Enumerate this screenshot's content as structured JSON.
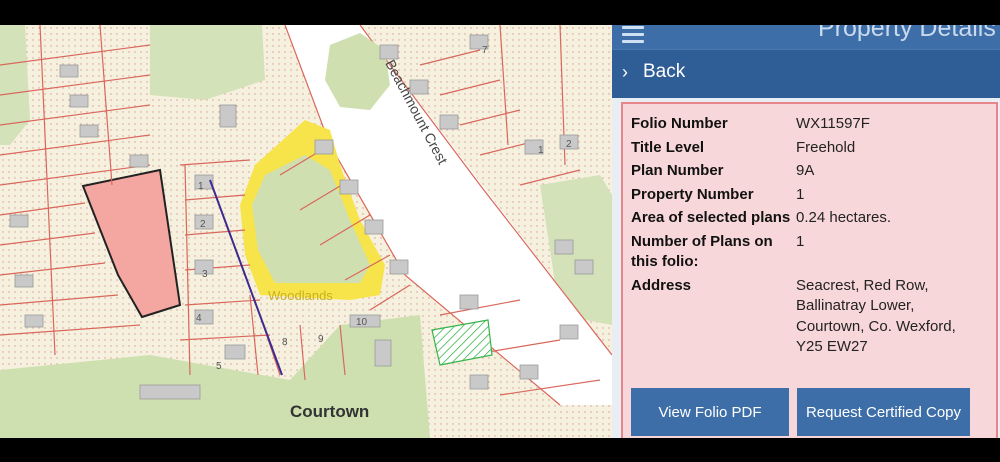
{
  "header": {
    "title": "Property Details",
    "menu_icon": "hamburger-icon"
  },
  "back": {
    "label": "Back",
    "icon": "chevron-right-icon"
  },
  "details": {
    "rows": [
      {
        "label": "Folio Number",
        "value": "WX11597F"
      },
      {
        "label": "Title Level",
        "value": "Freehold"
      },
      {
        "label": "Plan Number",
        "value": "9A"
      },
      {
        "label": "Property Number",
        "value": "1"
      },
      {
        "label": "Area of selected plans",
        "value": "0.24 hectares."
      },
      {
        "label": "Number of Plans on this folio:",
        "value": "1"
      },
      {
        "label": "Address",
        "value": "Seacrest, Red Row, Ballinatray Lower, Courtown, Co. Wexford, Y25 EW27"
      }
    ]
  },
  "buttons": {
    "view_folio": "View Folio PDF",
    "request_cert": "Request Certified Copy"
  },
  "map": {
    "labels": {
      "street": "Beachmount Crest",
      "area": "Woodlands",
      "town": "Courtown",
      "house_1": "1",
      "house_2": "2",
      "house_3": "3",
      "house_4": "4",
      "house_5": "5",
      "house_7": "7",
      "house_8": "8",
      "house_9": "9",
      "house_10": "10",
      "house_1b": "1",
      "house_2b": "2"
    }
  },
  "colors": {
    "accent": "#3d6ea8",
    "back_bar": "#2f5d96",
    "detail_bg": "#f8d7da",
    "detail_border": "#e8848c",
    "selected_parcel": "#f4a6a0",
    "map_bg": "#f6f1df",
    "boundary": "#d9675c",
    "green_space": "#c6d9a8",
    "highlight_yellow": "#f7e44a"
  }
}
